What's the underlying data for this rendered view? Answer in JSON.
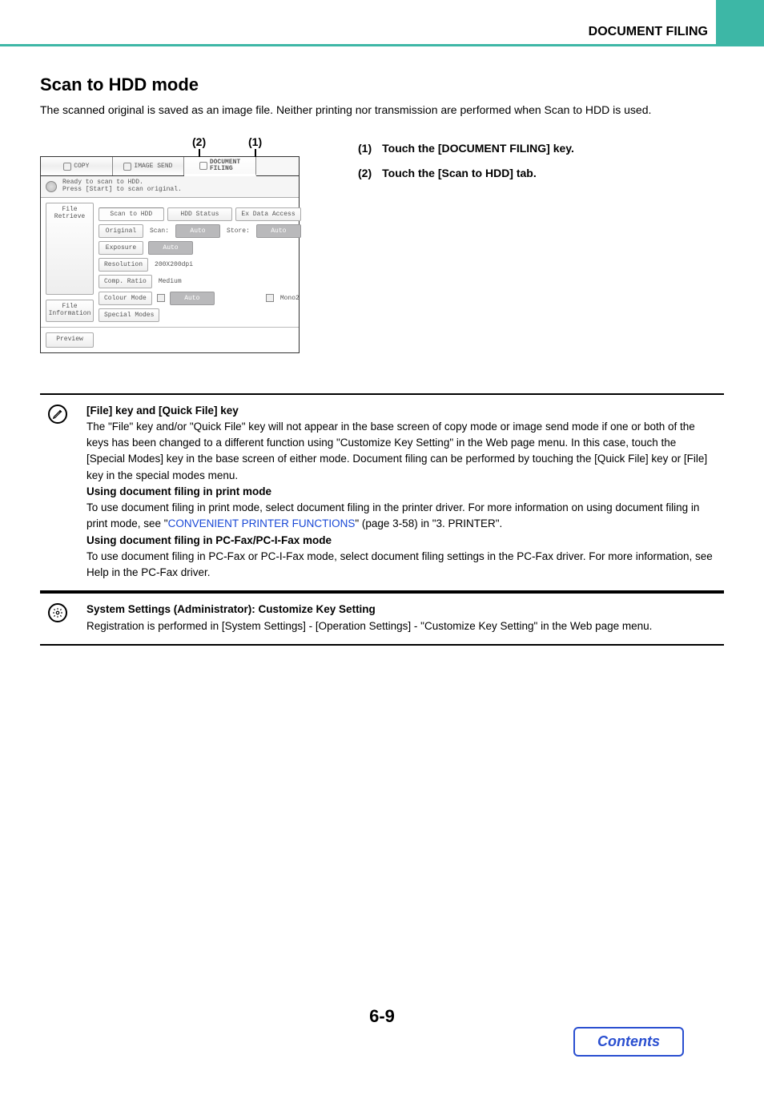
{
  "header": {
    "title": "DOCUMENT FILING"
  },
  "section": {
    "title": "Scan to HDD mode",
    "intro": "The scanned original is saved as an image file. Neither printing nor transmission are performed when Scan to HDD is used."
  },
  "callouts": {
    "c1": "(1)",
    "c2": "(2)"
  },
  "panel": {
    "tabs": {
      "copy": "COPY",
      "image_send": "IMAGE SEND",
      "doc_filing_l1": "DOCUMENT",
      "doc_filing_l2": "FILING"
    },
    "status_l1": "Ready to scan to HDD.",
    "status_l2": "Press [Start] to scan original.",
    "subtabs": {
      "file_retrieve": "File Retrieve",
      "scan_hdd": "Scan to HDD",
      "hdd_status": "HDD Status",
      "ex_data": "Ex Data Access"
    },
    "side": {
      "file_info_l1": "File",
      "file_info_l2": "Information",
      "preview": "Preview"
    },
    "rows": {
      "original": "Original",
      "scan_lbl": "Scan:",
      "auto": "Auto",
      "store_lbl": "Store:",
      "exposure": "Exposure",
      "resolution": "Resolution",
      "res_val": "200X200dpi",
      "comp": "Comp. Ratio",
      "comp_val": "Medium",
      "colour": "Colour Mode",
      "mono2": "Mono2",
      "special": "Special Modes"
    }
  },
  "steps": {
    "s1_num": "(1)",
    "s1_txt": "Touch the [DOCUMENT FILING] key.",
    "s2_num": "(2)",
    "s2_txt": "Touch the [Scan to HDD] tab."
  },
  "note1": {
    "h1": "[File] key and [Quick File] key",
    "p1": "The \"File\" key and/or \"Quick File\" key will not appear in the base screen of copy mode or image send mode if one or both of the keys has been changed to a different function using \"Customize Key Setting\" in the Web page menu. In this case, touch the [Special Modes] key in the base screen of either mode. Document filing can be performed by touching the [Quick File] key or [File] key in the special modes menu.",
    "h2": "Using document filing in print mode",
    "p2a": "To use document filing in print mode, select document filing in the printer driver. For more information on using document filing in print mode, see \"",
    "p2link": "CONVENIENT PRINTER FUNCTIONS",
    "p2b": "\" (page 3-58) in \"3. PRINTER\".",
    "h3": "Using document filing in PC-Fax/PC-I-Fax mode",
    "p3": "To use document filing in PC-Fax or PC-I-Fax mode, select document filing settings in the PC-Fax driver. For more information, see Help in the PC-Fax driver."
  },
  "note2": {
    "h1": "System Settings (Administrator): Customize Key Setting",
    "p1": "Registration is performed in [System Settings] - [Operation Settings] - \"Customize Key Setting\" in the Web page menu."
  },
  "footer": {
    "page_number": "6-9",
    "contents": "Contents"
  }
}
